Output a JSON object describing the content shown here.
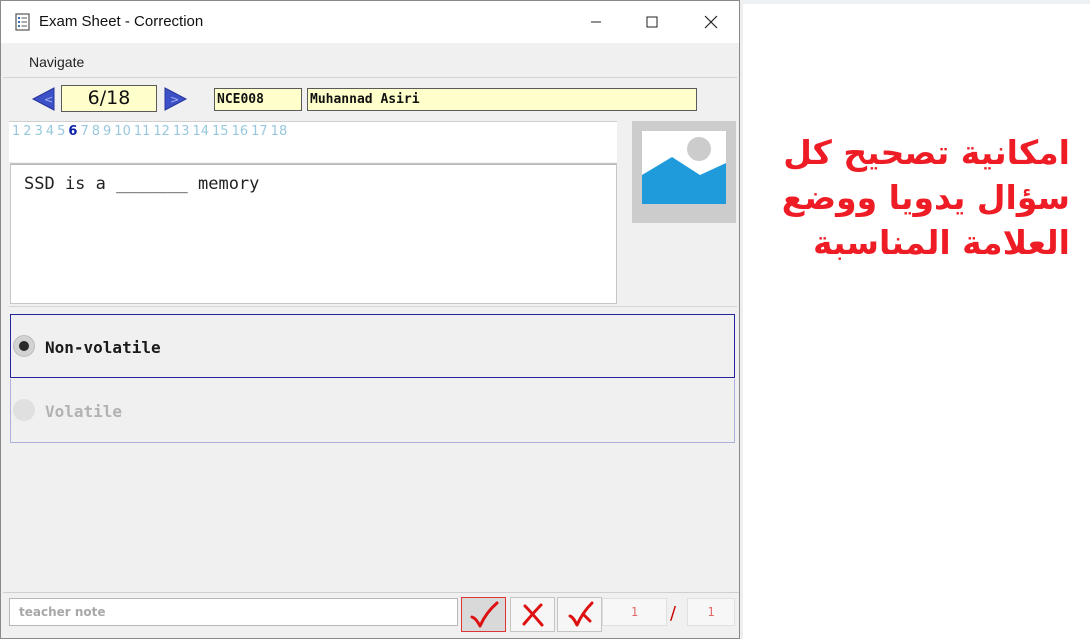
{
  "window": {
    "title": "Exam Sheet - Correction"
  },
  "menu": {
    "items": [
      "Navigate"
    ]
  },
  "nav": {
    "prev_label": "<",
    "next_label": ">",
    "counter": "6/18",
    "student_id": "NCE008",
    "student_name": "Muhannad Asiri"
  },
  "question_numbers": {
    "items": [
      "1",
      "2",
      "3",
      "4",
      "5",
      "6",
      "7",
      "8",
      "9",
      "10",
      "11",
      "12",
      "13",
      "14",
      "15",
      "16",
      "17",
      "18"
    ],
    "current": "6"
  },
  "question": {
    "text": "SSD is a _______ memory"
  },
  "options": [
    {
      "label": "Non-volatile",
      "selected": true
    },
    {
      "label": "Volatile",
      "selected": false
    }
  ],
  "footer": {
    "note_placeholder": "teacher note",
    "score_awarded": "1",
    "score_separator": "/",
    "score_total": "1"
  },
  "annotation": {
    "text": "امكانية تصحيح كل سؤال يدويا ووضع العلامة المناسبة"
  },
  "colors": {
    "accent_blue": "#3c50c8",
    "field_yellow": "#ffffcc",
    "annotation_red": "#ee1c24",
    "mark_red": "#dd1111",
    "image_placeholder_blue": "#1f9bdc"
  },
  "icons": {
    "app": "list-document-icon",
    "image": "image-placeholder-icon",
    "correct": "checkmark-icon",
    "wrong": "cross-icon",
    "partial": "partial-check-icon"
  }
}
